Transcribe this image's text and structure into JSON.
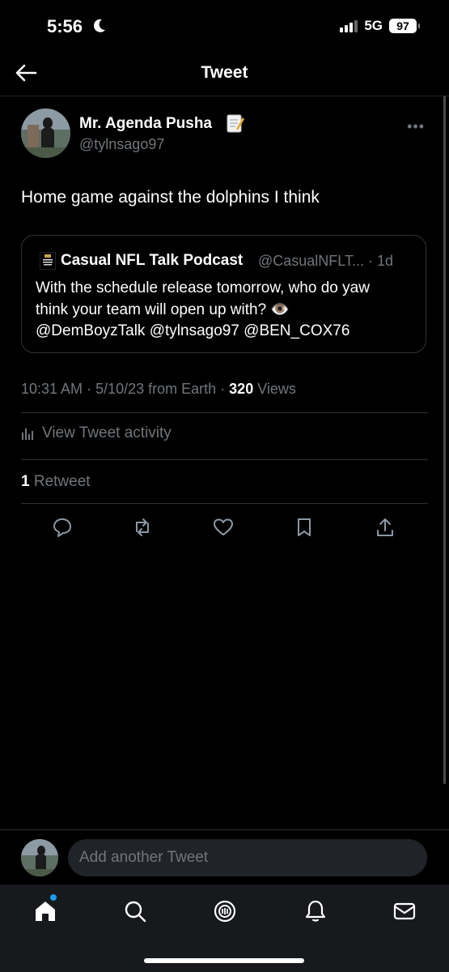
{
  "status": {
    "time": "5:56",
    "network": "5G",
    "battery": "97"
  },
  "nav": {
    "title": "Tweet"
  },
  "tweet": {
    "author_name": "Mr. Agenda Pusha",
    "author_emoji": "📝",
    "author_handle": "@tylnsago97",
    "text": "Home game against the dolphins I think",
    "time": "10:31 AM",
    "date": "5/10/23",
    "source": "from Earth",
    "views_count": "320",
    "views_label": "Views"
  },
  "quote": {
    "name": "Casual NFL Talk Podcast",
    "handle": "@CasualNFLT...",
    "age": "1d",
    "line1": "With the schedule release tomorrow, who do yaw",
    "line2": "think your team will open up  with? 👁️",
    "line3": "@DemBoyzTalk @tylnsago97 @BEN_COX76"
  },
  "activity": {
    "label": "View Tweet activity"
  },
  "retweets": {
    "count": "1",
    "label": "Retweet"
  },
  "reply": {
    "placeholder": "Add another Tweet"
  },
  "colors": {
    "accent": "#1d9bf0",
    "muted": "#71767b",
    "background": "#000000"
  },
  "icons": [
    "back-arrow-icon",
    "more-icon",
    "reply-icon",
    "retweet-icon",
    "like-icon",
    "bookmark-icon",
    "share-icon",
    "home-icon",
    "search-icon",
    "spaces-icon",
    "notifications-icon",
    "messages-icon"
  ]
}
